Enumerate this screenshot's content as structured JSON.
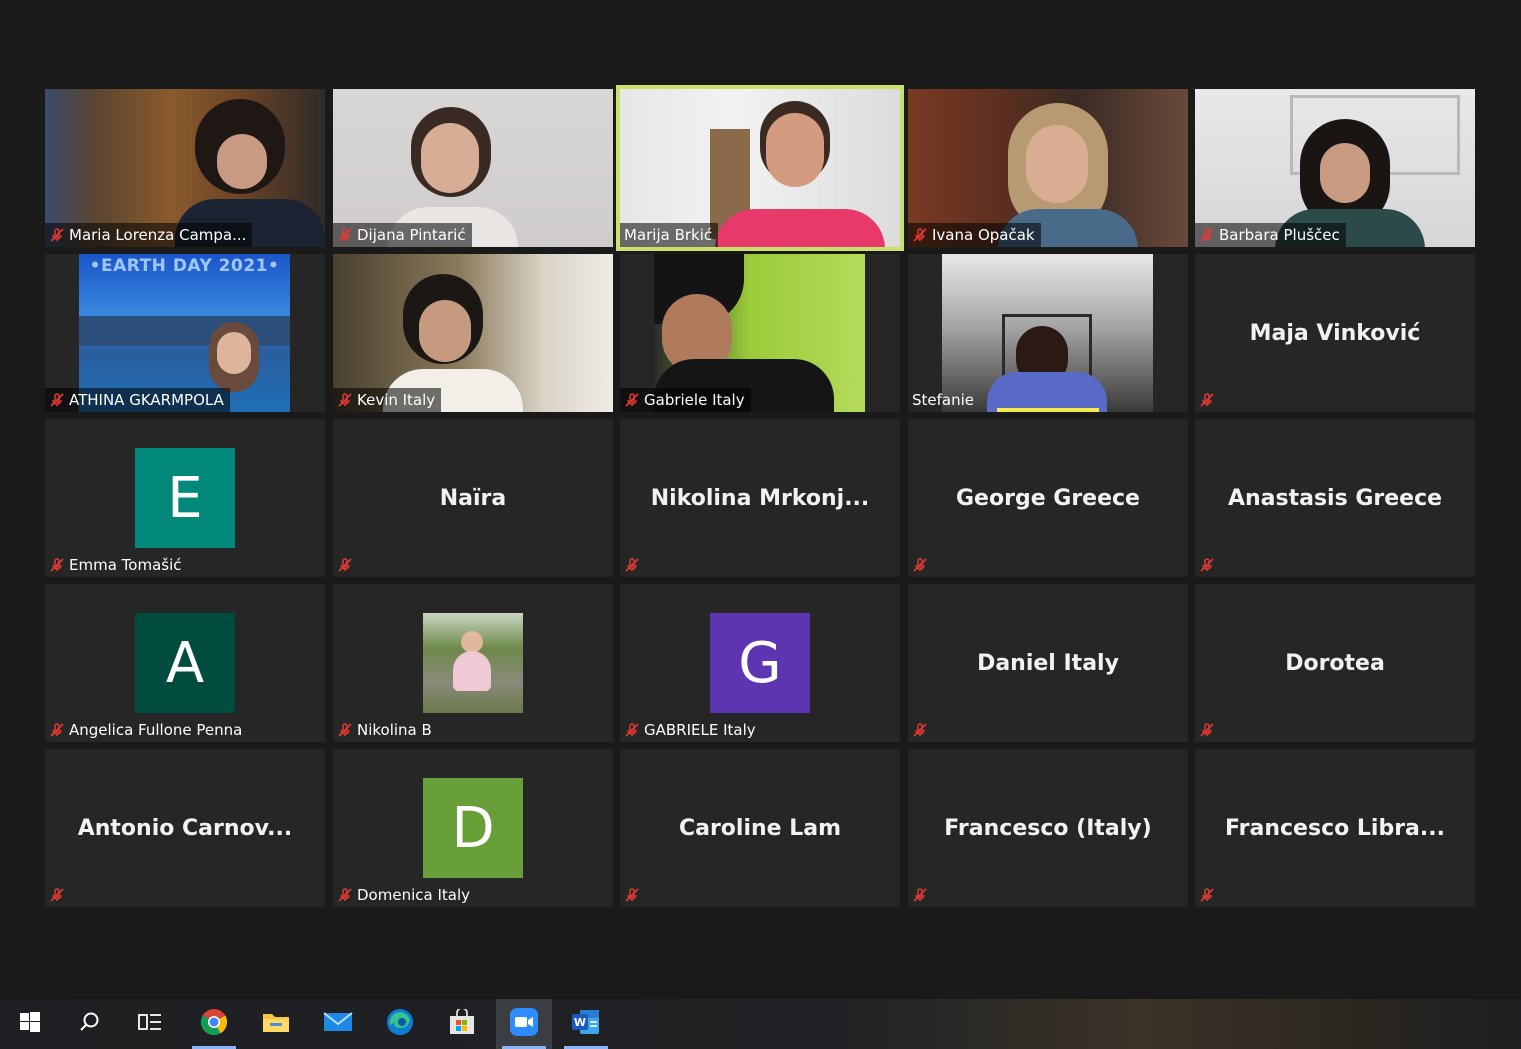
{
  "participants": [
    {
      "name": "Maria Lorenza Campa...",
      "big": ""
    },
    {
      "name": "Dijana Pintarić",
      "big": ""
    },
    {
      "name": "Marija Brkić",
      "big": ""
    },
    {
      "name": "Ivana Opačak",
      "big": ""
    },
    {
      "name": "Barbara Pluščec",
      "big": ""
    },
    {
      "name": "ATHINA GKARMPOLA",
      "big": "",
      "banner": "•EARTH DAY 2021•"
    },
    {
      "name": "Kevin Italy",
      "big": ""
    },
    {
      "name": "Gabriele Italy",
      "big": ""
    },
    {
      "name": "Stefanie",
      "big": ""
    },
    {
      "name": "",
      "big": "Maja Vinković"
    },
    {
      "name": "Emma Tomašić",
      "big": "",
      "initial": "E"
    },
    {
      "name": "",
      "big": "Naïra"
    },
    {
      "name": "",
      "big": "Nikolina  Mrkonj..."
    },
    {
      "name": "",
      "big": "George Greece"
    },
    {
      "name": "",
      "big": "Anastasis Greece"
    },
    {
      "name": "Angelica Fullone Penna",
      "big": "",
      "initial": "A"
    },
    {
      "name": "Nikolina B",
      "big": ""
    },
    {
      "name": "GABRIELE Italy",
      "big": "",
      "initial": "G"
    },
    {
      "name": "",
      "big": "Daniel Italy"
    },
    {
      "name": "",
      "big": "Dorotea"
    },
    {
      "name": "",
      "big": "Antonio  Carnov..."
    },
    {
      "name": "Domenica Italy",
      "big": "",
      "initial": "D"
    },
    {
      "name": "",
      "big": "Caroline Lam"
    },
    {
      "name": "",
      "big": "Francesco (Italy)"
    },
    {
      "name": "",
      "big": "Francesco  Libra..."
    }
  ],
  "colors": {
    "active_speaker": "#c7e16b",
    "avatar_E": "#00897b",
    "avatar_A": "#004d40",
    "avatar_G": "#5e35b1",
    "avatar_D": "#689f38",
    "mic_muted": "#e53935"
  },
  "taskbar": {
    "icons": [
      "windows-start-icon",
      "search-icon",
      "task-view-icon",
      "chrome-icon",
      "file-explorer-icon",
      "mail-icon",
      "edge-icon",
      "store-icon",
      "zoom-icon",
      "word-icon"
    ]
  }
}
